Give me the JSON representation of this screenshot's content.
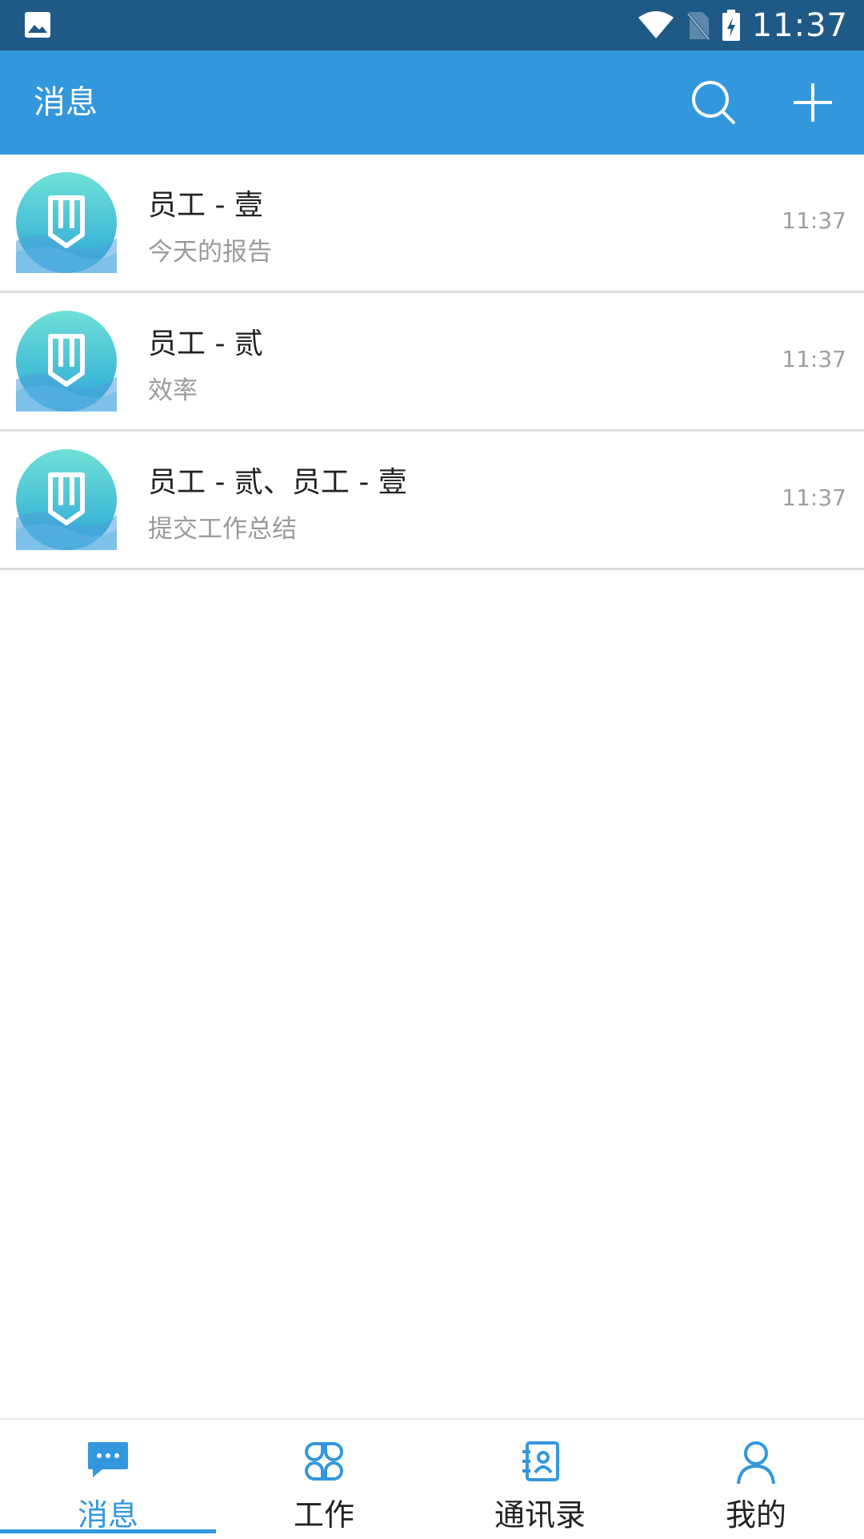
{
  "status_bar": {
    "time": "11:37",
    "icons": [
      "gallery-icon",
      "wifi-icon",
      "no-sim-icon",
      "battery-charging-icon"
    ]
  },
  "toolbar": {
    "title": "消息",
    "actions": [
      "search-icon",
      "add-icon"
    ]
  },
  "conversations": [
    {
      "name": "员工 - 壹",
      "snippet": "今天的报告",
      "time": "11:37"
    },
    {
      "name": "员工 - 贰",
      "snippet": "效率",
      "time": "11:37"
    },
    {
      "name": "员工 - 贰、员工 - 壹",
      "snippet": "提交工作总结",
      "time": "11:37"
    }
  ],
  "bottom_nav": {
    "active": 0,
    "tabs": [
      {
        "label": "消息",
        "icon": "chat-bubble-icon"
      },
      {
        "label": "工作",
        "icon": "apps-grid-icon"
      },
      {
        "label": "通讯录",
        "icon": "contacts-book-icon"
      },
      {
        "label": "我的",
        "icon": "person-icon"
      }
    ]
  },
  "colors": {
    "status_bar": "#1f5a86",
    "toolbar": "#3397dd",
    "accent": "#3397dd",
    "divider": "#dedede",
    "secondary_text": "#9a9a9a"
  }
}
